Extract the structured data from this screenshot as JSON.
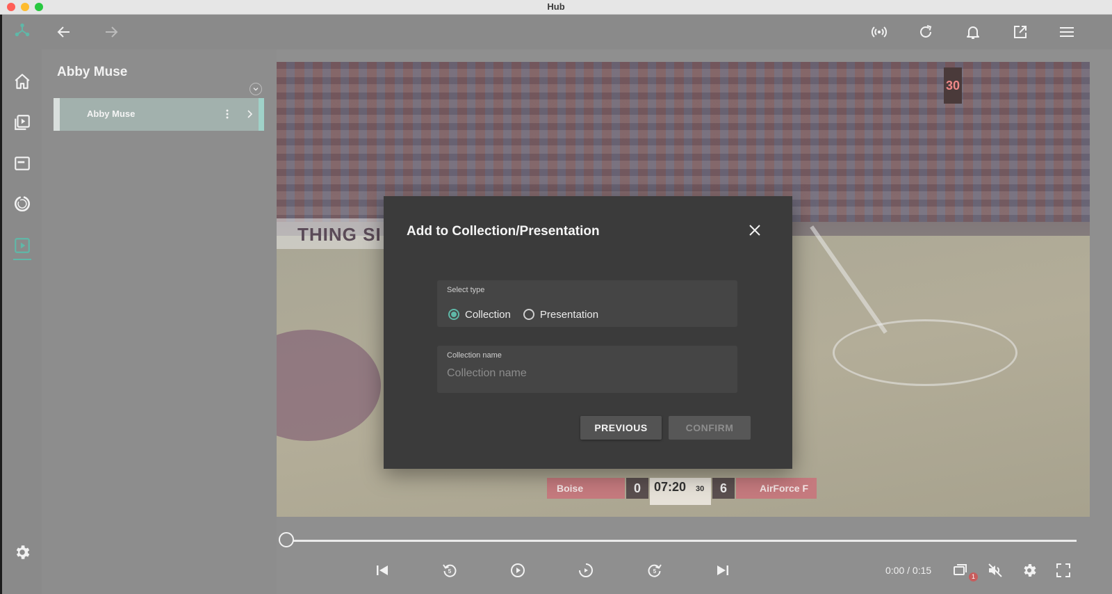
{
  "window": {
    "title": "Hub"
  },
  "topbar": {
    "icons": [
      "back-arrow-icon",
      "forward-arrow-icon",
      "broadcast-icon",
      "refresh-icon",
      "bell-icon",
      "open-external-icon",
      "menu-icon"
    ]
  },
  "rail": {
    "icons": [
      "logo-icon",
      "home-icon",
      "video-library-icon",
      "playlist-icon",
      "circle-sync-icon",
      "play-square-icon",
      "settings-icon"
    ]
  },
  "panel": {
    "title": "Abby Muse",
    "items": [
      {
        "label": "Abby Muse"
      }
    ]
  },
  "video": {
    "banner_text": "THING SI",
    "shot_clock": "30",
    "scoreboard": {
      "home_team": "Boise",
      "home_score": "0",
      "clock": "07:20",
      "shot": "30",
      "away_score": "6",
      "away_team": "AirForce F"
    }
  },
  "player": {
    "time": "0:00 / 0:15",
    "badge": "1",
    "progress": 0
  },
  "dialog": {
    "title": "Add to Collection/Presentation",
    "type_label": "Select type",
    "options": [
      "Collection",
      "Presentation"
    ],
    "selected": "Collection",
    "name_label": "Collection name",
    "name_placeholder": "Collection name",
    "name_value": "",
    "previous_label": "PREVIOUS",
    "confirm_label": "CONFIRM"
  },
  "colors": {
    "accent": "#5fb8a8",
    "dialog_bg": "#3b3b3b",
    "overlay": "#8a8a8a"
  }
}
